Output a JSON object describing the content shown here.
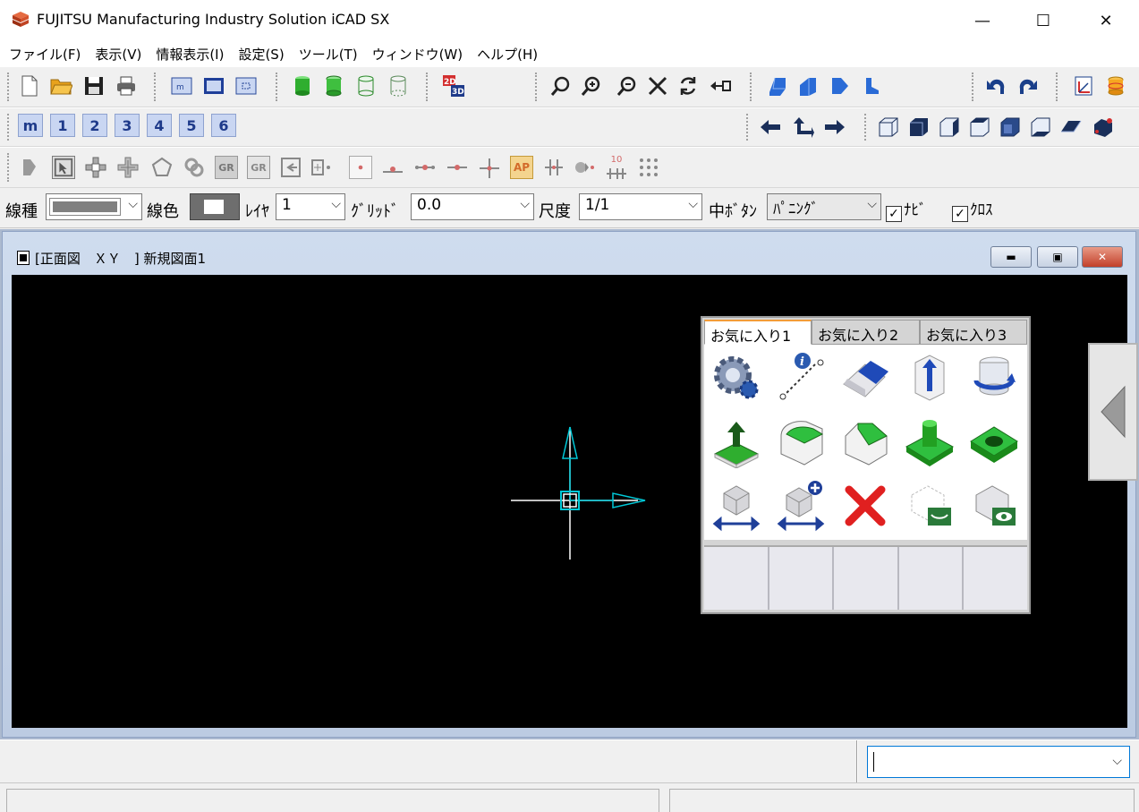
{
  "window": {
    "title": "FUJITSU Manufacturing Industry Solution iCAD SX",
    "minimize": "—",
    "maximize": "☐",
    "close": "✕"
  },
  "menu": [
    "ファイル(F)",
    "表示(V)",
    "情報表示(I)",
    "設定(S)",
    "ツール(T)",
    "ウィンドウ(W)",
    "ヘルプ(H)"
  ],
  "toolbar_row2": {
    "m_button": "m",
    "layer_buttons": [
      "1",
      "2",
      "3",
      "4",
      "5",
      "6"
    ]
  },
  "toolbar_row3": {
    "gr1": "GR",
    "gr2": "GR",
    "ap": "AP",
    "ten": "10"
  },
  "properties": {
    "line_type_label": "線種",
    "line_color_label": "線色",
    "layer_label": "ﾚｲﾔ",
    "layer_value": "1",
    "grid_label": "ｸﾞﾘｯﾄﾞ",
    "grid_value": "0.0",
    "scale_label": "尺度",
    "scale_value": "1/1",
    "middle_button_label": "中ﾎﾞﾀﾝ",
    "middle_button_value": "ﾊﾟﾆﾝｸﾞ",
    "navi_label": "ﾅﾋﾞ",
    "cross_label": "ｸﾛｽ",
    "navi_checked": true,
    "cross_checked": true,
    "check_mark": "✓",
    "dropdown_arrow": "⌵"
  },
  "drawing_window": {
    "title": "[正面図　ＸＹ　] 新規図面1",
    "minimize": "▬",
    "restore": "▣",
    "close": "✕"
  },
  "favorites": {
    "tabs": [
      "お気に入り1",
      "お気に入り2",
      "お気に入り3"
    ],
    "active_tab": 0,
    "icons": [
      "gear-settings-icon",
      "info-dotted-line-icon",
      "eraser-icon",
      "extrude-arrow-icon",
      "rotate-cylinder-icon",
      "push-face-icon",
      "fillet-edge-icon",
      "chamfer-edge-icon",
      "boss-icon",
      "hole-icon",
      "move-solid-icon",
      "copy-solid-icon",
      "delete-x-icon",
      "hide-solid-icon",
      "show-solid-icon"
    ]
  },
  "colors": {
    "canvas": "#000000",
    "axis_cyan": "#00c8d7",
    "accent_blue": "#0078d7"
  }
}
